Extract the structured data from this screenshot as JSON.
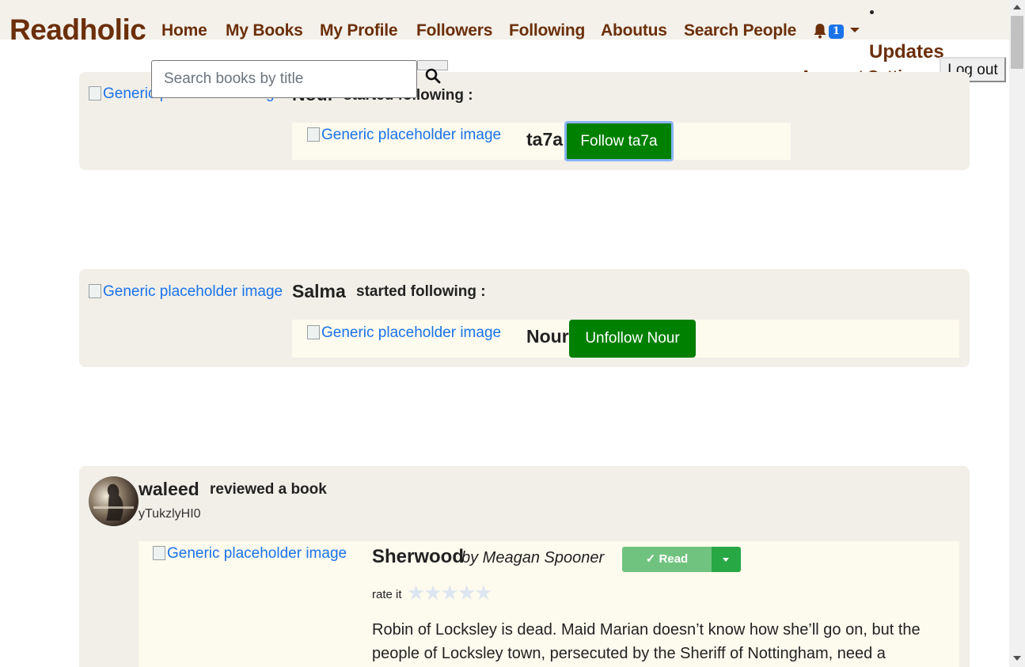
{
  "nav": {
    "brand": "Readholic",
    "links": [
      "Home",
      "My Books",
      "My Profile",
      "Followers",
      "Following",
      "Aboutus",
      "Search People"
    ],
    "notification_count": "1",
    "updates_label": "Updates",
    "account_settings": "Account Settings",
    "logout_label": "Log out"
  },
  "search": {
    "placeholder": "Search books by title"
  },
  "feed": [
    {
      "img_alt": "Generic placeholder image",
      "actor": "Nour",
      "action": "started following :",
      "target_img_alt": "Generic placeholder image",
      "target": "ta7a",
      "button": "Follow ta7a"
    },
    {
      "img_alt": "Generic placeholder image",
      "actor": "Salma",
      "action": "started following :",
      "target_img_alt": "Generic placeholder image",
      "target": "Nour",
      "button": "Unfollow Nour"
    },
    {
      "actor": "waleed",
      "action": "reviewed a book",
      "handle": "yTukzlyHI0",
      "book_img_alt": "Generic placeholder image",
      "book_title": "Sherwood",
      "book_author": "by Meagan Spooner",
      "shelf_status": "✓ Read",
      "rate_label": "rate it",
      "rating": 0,
      "description": "Robin of Locksley is dead. Maid Marian doesn’t know how she’ll go on, but the people of Locksley town, persecuted by the Sheriff of Nottingham, need a"
    }
  ],
  "colors": {
    "brand": "#6b2f0a",
    "card_bg": "#f2efe9",
    "inner_bg": "#fdfaee",
    "follow_button": "#008000",
    "read_button": "#70c37f",
    "link": "#1a73e8"
  }
}
